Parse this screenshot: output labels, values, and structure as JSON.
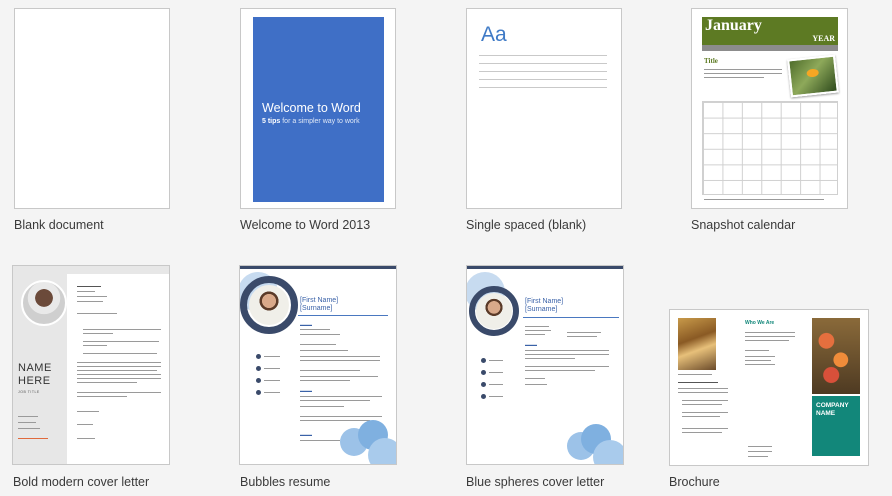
{
  "templates": [
    {
      "id": "blank",
      "label": "Blank document"
    },
    {
      "id": "welcome",
      "label": "Welcome to Word 2013",
      "cover_title": "Welcome to Word",
      "cover_subtitle_bold": "5 tips",
      "cover_subtitle_rest": " for a simpler way to work"
    },
    {
      "id": "single-spaced",
      "label": "Single spaced (blank)",
      "sample_glyph": "Aa"
    },
    {
      "id": "snapshot-calendar",
      "label": "Snapshot calendar",
      "month": "January",
      "year": "YEAR",
      "title": "Title"
    },
    {
      "id": "bold-modern",
      "label": "Bold modern cover letter",
      "name_line1": "NAME",
      "name_line2": "HERE",
      "job_title": "JOB TITLE"
    },
    {
      "id": "bubbles",
      "label": "Bubbles resume",
      "name1": "[First Name]",
      "name2": "[Surname]"
    },
    {
      "id": "blue-spheres",
      "label": "Blue spheres cover letter",
      "name1": "[First Name]",
      "name2": "[Surname]"
    },
    {
      "id": "brochure",
      "label": "Brochure",
      "heading": "Who We Are",
      "company1": "COMPANY",
      "company2": "NAME"
    }
  ],
  "colors": {
    "word_blue": "#3f6fc6",
    "calendar_green": "#5d7a23",
    "brochure_teal": "#12877a",
    "resume_navy": "#3a4a6a"
  }
}
